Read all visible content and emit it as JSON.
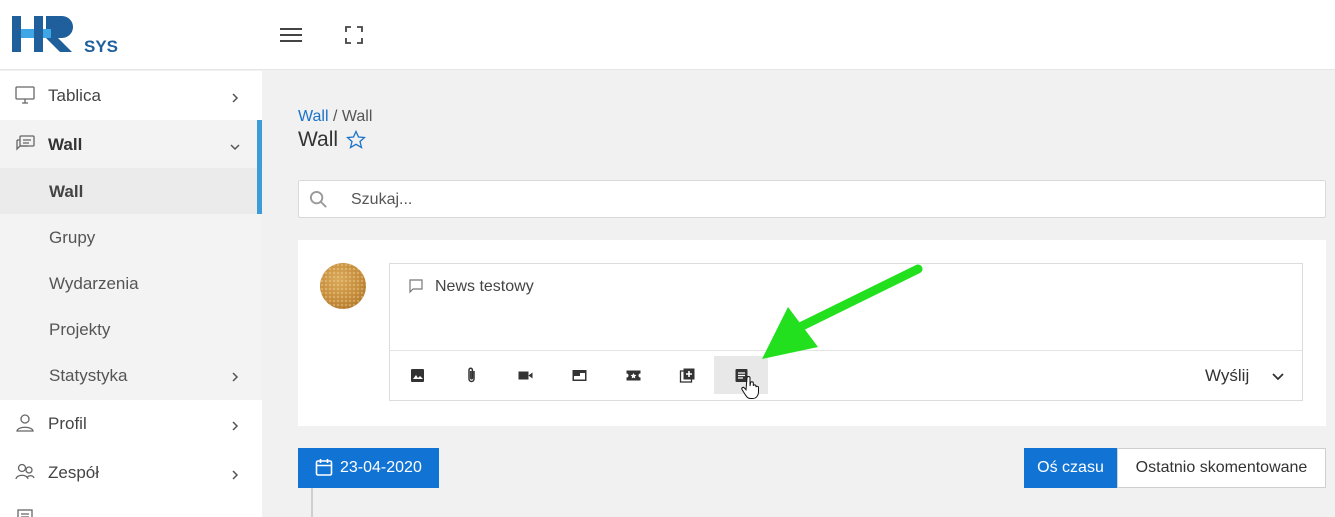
{
  "app": {
    "logo_text_main": "HR",
    "logo_text_sub": "SYS",
    "brand_blue": "#1f5f9c",
    "brand_light": "#3fa6e6",
    "accent": "#1173d4"
  },
  "sidebar": {
    "items": [
      {
        "label": "Tablica",
        "icon": "monitor-icon"
      },
      {
        "label": "Wall",
        "icon": "chat-icon",
        "expanded": true,
        "sub": [
          {
            "label": "Wall",
            "active": true
          },
          {
            "label": "Grupy"
          },
          {
            "label": "Wydarzenia"
          },
          {
            "label": "Projekty"
          },
          {
            "label": "Statystyka"
          }
        ]
      },
      {
        "label": "Profil",
        "icon": "user-icon"
      },
      {
        "label": "Zespół",
        "icon": "team-icon"
      }
    ]
  },
  "breadcrumb": {
    "link": "Wall",
    "separator": "/",
    "current": "Wall"
  },
  "page_title": "Wall",
  "search": {
    "placeholder": "Szukaj..."
  },
  "composer": {
    "text": "News testowy",
    "tools": [
      "image-icon",
      "attachment-icon",
      "video-icon",
      "card-icon",
      "ticket-icon",
      "add-box-icon",
      "article-icon"
    ],
    "send_label": "Wyślij"
  },
  "timeline": {
    "date": "23-04-2020",
    "tabs": [
      {
        "label": "Oś czasu",
        "active": true
      },
      {
        "label": "Ostatnio skomentowane",
        "active": false
      }
    ]
  }
}
